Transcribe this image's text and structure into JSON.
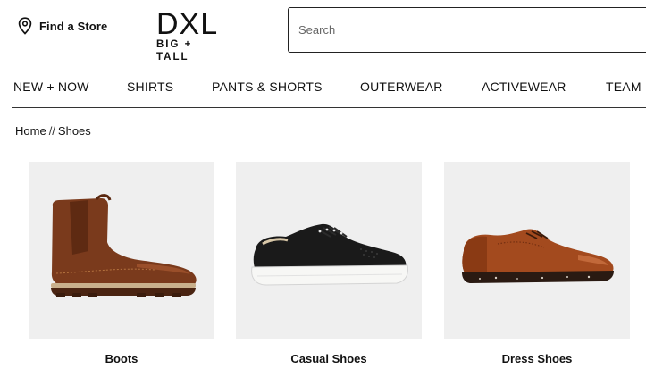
{
  "header": {
    "find_store_label": "Find a Store",
    "logo": {
      "mark": "DXL",
      "tagline": "BIG + TALL"
    },
    "search": {
      "placeholder": "Search",
      "value": ""
    }
  },
  "nav": {
    "items": [
      {
        "label": "NEW + NOW"
      },
      {
        "label": "SHIRTS"
      },
      {
        "label": "PANTS & SHORTS"
      },
      {
        "label": "OUTERWEAR"
      },
      {
        "label": "ACTIVEWEAR"
      },
      {
        "label": "TEAM I"
      }
    ]
  },
  "breadcrumb": {
    "home": "Home",
    "separator": "//",
    "current": "Shoes"
  },
  "categories": [
    {
      "name": "Boots",
      "image": "brown-chelsea-boot",
      "color": "#7a3a1c"
    },
    {
      "name": "Casual Shoes",
      "image": "black-leather-sneaker",
      "color": "#1a1a1a"
    },
    {
      "name": "Dress Shoes",
      "image": "brown-derby-dress-shoe",
      "color": "#a34a1e"
    }
  ],
  "colors": {
    "text": "#111111",
    "tile_background": "#efefef",
    "rule": "#333333"
  }
}
